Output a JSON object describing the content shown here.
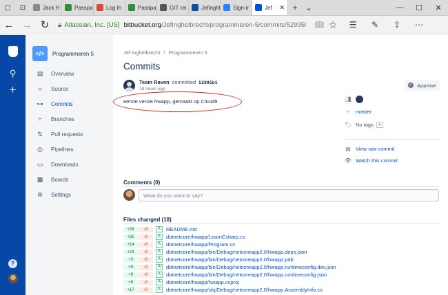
{
  "browser": {
    "tabs": [
      {
        "label": "Jack H",
        "color": "#8a8a8a"
      },
      {
        "label": "Passpa",
        "color": "#2f8f3a"
      },
      {
        "label": "Log In",
        "color": "#d84a3a"
      },
      {
        "label": "Passpa",
        "color": "#2f8f3a"
      },
      {
        "label": "GIT rei",
        "color": "#555555"
      },
      {
        "label": "Jefinghl",
        "color": "#0b5394"
      },
      {
        "label": "Sign-ir",
        "color": "#2684ff"
      },
      {
        "label": "Jef",
        "color": "#0052cc"
      }
    ],
    "active_tab_close": "✕",
    "new_tab": "+",
    "tab_menu": "⌄",
    "window_controls": [
      "—",
      "☐",
      "✕"
    ],
    "url": {
      "org": "Atlassian, Inc. [US]",
      "host": "bitbucket.org",
      "path": "/JefInghelbrecht/programmeren-5/commits/52995l"
    }
  },
  "project": {
    "name": "Programmeren 5",
    "avatar_text": "</>"
  },
  "sidebar": {
    "items": [
      {
        "label": "Overview",
        "icon": "▤"
      },
      {
        "label": "Source",
        "icon": "‹›"
      },
      {
        "label": "Commits",
        "icon": "⊶"
      },
      {
        "label": "Branches",
        "icon": "⑂"
      },
      {
        "label": "Pull requests",
        "icon": "⇅"
      },
      {
        "label": "Pipelines",
        "icon": "◎"
      },
      {
        "label": "Downloads",
        "icon": "▭"
      },
      {
        "label": "Boards",
        "icon": "▦"
      },
      {
        "label": "Settings",
        "icon": "⚙"
      }
    ],
    "active_index": 2
  },
  "breadcrumb": {
    "owner": "Jef Inghelbrecht",
    "separator": "/",
    "repo": "Programmeren 5"
  },
  "page": {
    "title": "Commits"
  },
  "commit": {
    "author": "Team Raven",
    "verb": "committed",
    "hash": "52995b1",
    "time": "18 hours ago",
    "message": "eerste versie hwapp, gemaakt op Cloud9",
    "approve_label": "Approve",
    "branch": "master",
    "tags": "No tags",
    "tags_add": "+",
    "raw_link": "View raw commit",
    "watch_link": "Watch this commit"
  },
  "comments": {
    "header": "Comments (0)",
    "placeholder": "What do you want to say?"
  },
  "files_changed": {
    "header": "Files changed (18)",
    "files": [
      {
        "add": "+26",
        "del": "-0",
        "status": "A",
        "path": "README.md"
      },
      {
        "add": "+31",
        "del": "-0",
        "status": "A",
        "path": "dotnetcore/hwapp/LearnCsharp.cs"
      },
      {
        "add": "+14",
        "del": "-0",
        "status": "A",
        "path": "dotnetcore/hwapp/Program.cs"
      },
      {
        "add": "+23",
        "del": "-0",
        "status": "A",
        "path": "dotnetcore/hwapp/bin/Debug/netcoreapp2.0/hwapp.deps.json"
      },
      {
        "add": "+0",
        "del": "-0",
        "status": "A",
        "path": "dotnetcore/hwapp/bin/Debug/netcoreapp2.0/hwapp.pdb"
      },
      {
        "add": "+9",
        "del": "-0",
        "status": "A",
        "path": "dotnetcore/hwapp/bin/Debug/netcoreapp2.0/hwapp.runtimeconfig.dev.json"
      },
      {
        "add": "+9",
        "del": "-0",
        "status": "A",
        "path": "dotnetcore/hwapp/bin/Debug/netcoreapp2.0/hwapp.runtimeconfig.json"
      },
      {
        "add": "+8",
        "del": "-0",
        "status": "A",
        "path": "dotnetcore/hwapp/hwapp.csproj"
      },
      {
        "add": "+17",
        "del": "-0",
        "status": "A",
        "path": "dotnetcore/hwapp/obj/Debug/netcoreapp2.0/hwapp.AssemblyInfo.cs"
      }
    ]
  }
}
